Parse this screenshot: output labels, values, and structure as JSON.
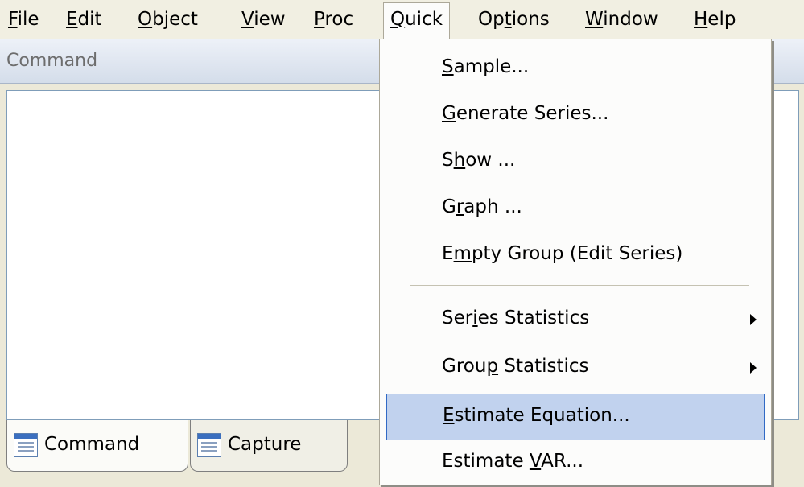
{
  "menubar": {
    "items": [
      {
        "pre": "",
        "key": "F",
        "post": "ile"
      },
      {
        "pre": "",
        "key": "E",
        "post": "dit"
      },
      {
        "pre": "",
        "key": "O",
        "post": "bject"
      },
      {
        "pre": "",
        "key": "V",
        "post": "iew"
      },
      {
        "pre": "",
        "key": "P",
        "post": "roc"
      },
      {
        "pre": "",
        "key": "Q",
        "post": "uick"
      },
      {
        "pre": "Op",
        "key": "t",
        "post": "ions"
      },
      {
        "pre": "",
        "key": "W",
        "post": "indow"
      },
      {
        "pre": "",
        "key": "H",
        "post": "elp"
      }
    ]
  },
  "command": {
    "title": "Command"
  },
  "tabs": [
    {
      "label": "Command"
    },
    {
      "label": "Capture"
    }
  ],
  "quick_menu": {
    "items": [
      {
        "pre": "",
        "key": "S",
        "post": "ample..."
      },
      {
        "pre": "",
        "key": "G",
        "post": "enerate Series..."
      },
      {
        "pre": "S",
        "key": "h",
        "post": "ow ..."
      },
      {
        "pre": "G",
        "key": "r",
        "post": "aph ..."
      },
      {
        "pre": "E",
        "key": "m",
        "post": "pty Group (Edit Series)"
      },
      {
        "pre": "Ser",
        "key": "i",
        "post": "es Statistics"
      },
      {
        "pre": "Grou",
        "key": "p",
        "post": " Statistics"
      },
      {
        "pre": "",
        "key": "E",
        "post": "stimate Equation..."
      },
      {
        "pre": "Estimate ",
        "key": "V",
        "post": "AR..."
      }
    ]
  }
}
